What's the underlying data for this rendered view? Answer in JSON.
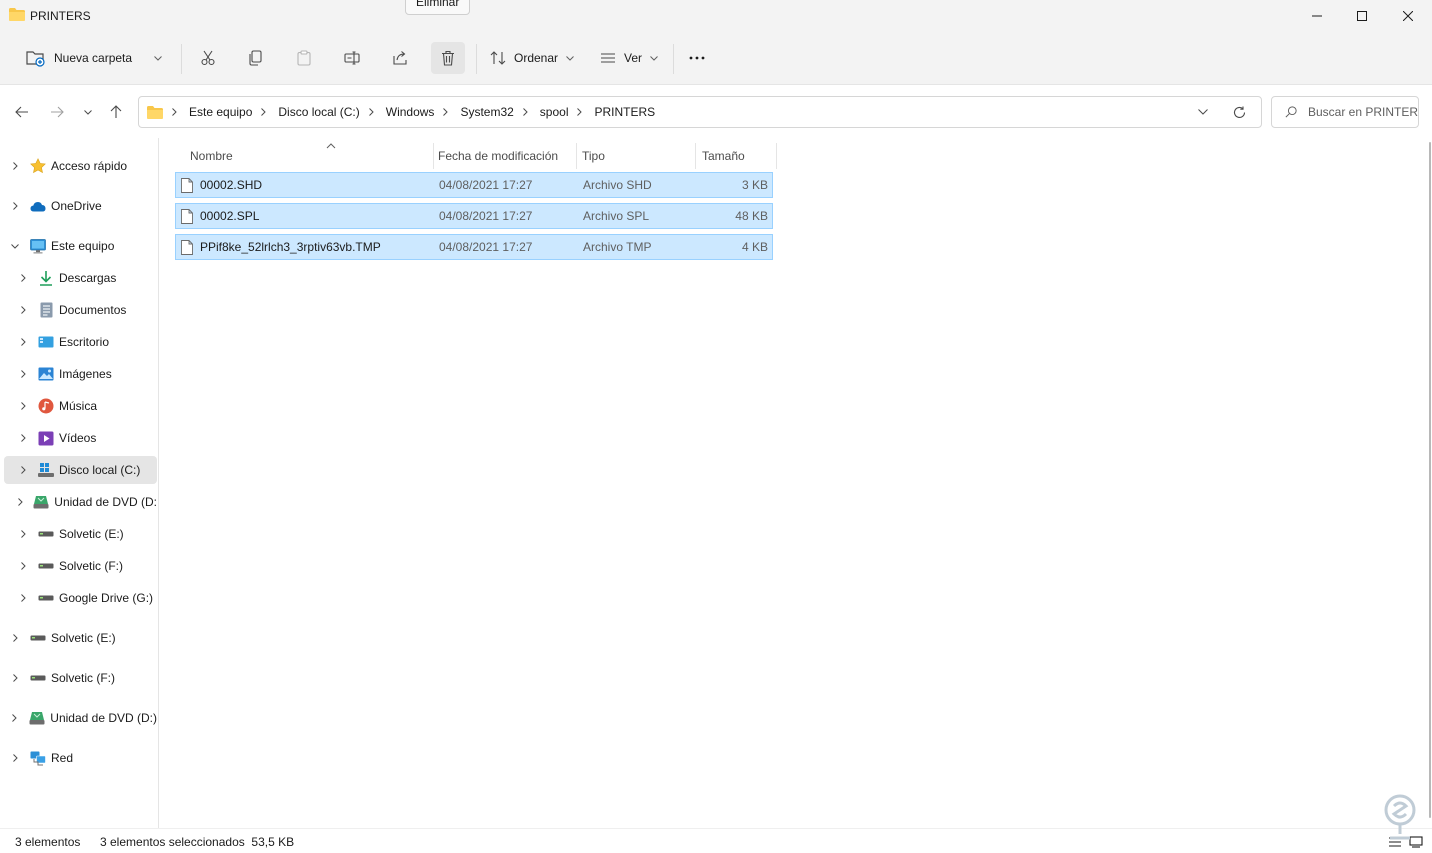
{
  "window": {
    "title": "PRINTERS",
    "tooltip": "Eliminar"
  },
  "toolbar": {
    "new_folder_label": "Nueva carpeta",
    "sort_label": "Ordenar",
    "view_label": "Ver"
  },
  "address": {
    "crumbs": [
      "Este equipo",
      "Disco local (C:)",
      "Windows",
      "System32",
      "spool",
      "PRINTERS"
    ],
    "search_placeholder": "Buscar en PRINTERS"
  },
  "sidebar": {
    "items": [
      {
        "label": "Acceso rápido",
        "icon": "star-icon",
        "expanded": false
      },
      {
        "label": "OneDrive",
        "icon": "cloud-icon",
        "expanded": false
      },
      {
        "label": "Este equipo",
        "icon": "monitor-icon",
        "expanded": true
      },
      {
        "label": "Descargas",
        "icon": "download-icon",
        "expanded": false
      },
      {
        "label": "Documentos",
        "icon": "document-icon",
        "expanded": false
      },
      {
        "label": "Escritorio",
        "icon": "desktop-icon",
        "expanded": false
      },
      {
        "label": "Imágenes",
        "icon": "image-icon",
        "expanded": false
      },
      {
        "label": "Música",
        "icon": "music-icon",
        "expanded": false
      },
      {
        "label": "Vídeos",
        "icon": "video-icon",
        "expanded": false
      },
      {
        "label": "Disco local (C:)",
        "icon": "windows-drive-icon",
        "expanded": false,
        "selected": true
      },
      {
        "label": "Unidad de DVD (D:",
        "icon": "dvd-drive-icon",
        "expanded": false
      },
      {
        "label": "Solvetic (E:)",
        "icon": "drive-icon",
        "expanded": false
      },
      {
        "label": "Solvetic (F:)",
        "icon": "drive-icon",
        "expanded": false
      },
      {
        "label": "Google Drive (G:)",
        "icon": "drive-icon",
        "expanded": false
      },
      {
        "label": "Solvetic (E:)",
        "icon": "drive-icon",
        "expanded": false
      },
      {
        "label": "Solvetic (F:)",
        "icon": "drive-icon",
        "expanded": false
      },
      {
        "label": "Unidad de DVD (D:)",
        "icon": "dvd-drive-icon",
        "expanded": false
      },
      {
        "label": "Red",
        "icon": "network-icon",
        "expanded": false
      }
    ]
  },
  "columns": {
    "name": "Nombre",
    "date": "Fecha de modificación",
    "type": "Tipo",
    "size": "Tamaño"
  },
  "files": [
    {
      "name": "00002.SHD",
      "date": "04/08/2021 17:27",
      "type": "Archivo SHD",
      "size": "3 KB",
      "selected": true
    },
    {
      "name": "00002.SPL",
      "date": "04/08/2021 17:27",
      "type": "Archivo SPL",
      "size": "48 KB",
      "selected": true
    },
    {
      "name": "PPif8ke_52lrlch3_3rptiv63vb.TMP",
      "date": "04/08/2021 17:27",
      "type": "Archivo TMP",
      "size": "4 KB",
      "selected": true
    }
  ],
  "status": {
    "count": "3 elementos",
    "selection": "3 elementos seleccionados  53,5 KB"
  },
  "colors": {
    "selection_bg": "#cce8ff",
    "selection_border": "#99d1ff",
    "folder_yellow": "#f8c74a",
    "chrome_bg": "#f3f3f3"
  }
}
